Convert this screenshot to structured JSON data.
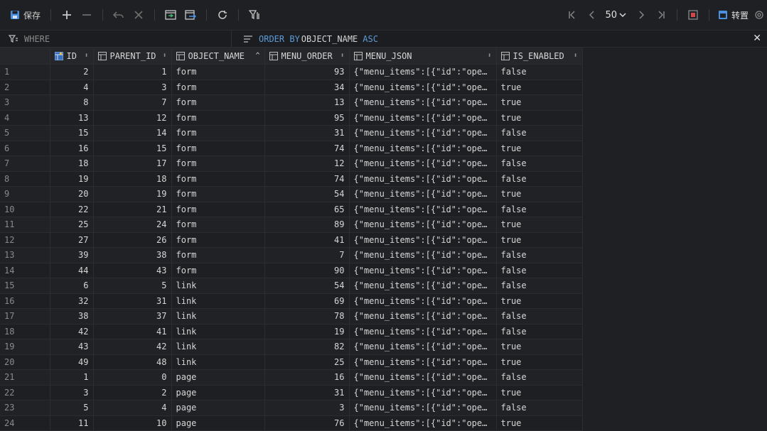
{
  "toolbar": {
    "save_label": "保存",
    "page_size": "50",
    "transpose_label": "转置"
  },
  "filter": {
    "where_placeholder": "WHERE",
    "order_kw": "ORDER BY",
    "order_col": "OBJECT_NAME",
    "order_dir": "ASC"
  },
  "columns": [
    {
      "label": "ID",
      "sort": "⬍"
    },
    {
      "label": "PARENT_ID",
      "sort": "⬍"
    },
    {
      "label": "OBJECT_NAME",
      "sort": "^"
    },
    {
      "label": "MENU_ORDER",
      "sort": "⬍"
    },
    {
      "label": "MENU_JSON",
      "sort": "⬍"
    },
    {
      "label": "IS_ENABLED",
      "sort": "⬍"
    }
  ],
  "rows": [
    [
      "1",
      "2",
      "1",
      "form",
      "93",
      "{\"menu_items\":[{\"id\":\"ope…",
      "false"
    ],
    [
      "2",
      "4",
      "3",
      "form",
      "34",
      "{\"menu_items\":[{\"id\":\"ope…",
      "true"
    ],
    [
      "3",
      "8",
      "7",
      "form",
      "13",
      "{\"menu_items\":[{\"id\":\"ope…",
      "true"
    ],
    [
      "4",
      "13",
      "12",
      "form",
      "95",
      "{\"menu_items\":[{\"id\":\"ope…",
      "true"
    ],
    [
      "5",
      "15",
      "14",
      "form",
      "31",
      "{\"menu_items\":[{\"id\":\"ope…",
      "false"
    ],
    [
      "6",
      "16",
      "15",
      "form",
      "74",
      "{\"menu_items\":[{\"id\":\"ope…",
      "true"
    ],
    [
      "7",
      "18",
      "17",
      "form",
      "12",
      "{\"menu_items\":[{\"id\":\"ope…",
      "false"
    ],
    [
      "8",
      "19",
      "18",
      "form",
      "74",
      "{\"menu_items\":[{\"id\":\"ope…",
      "false"
    ],
    [
      "9",
      "20",
      "19",
      "form",
      "54",
      "{\"menu_items\":[{\"id\":\"ope…",
      "true"
    ],
    [
      "10",
      "22",
      "21",
      "form",
      "65",
      "{\"menu_items\":[{\"id\":\"ope…",
      "false"
    ],
    [
      "11",
      "25",
      "24",
      "form",
      "89",
      "{\"menu_items\":[{\"id\":\"ope…",
      "true"
    ],
    [
      "12",
      "27",
      "26",
      "form",
      "41",
      "{\"menu_items\":[{\"id\":\"ope…",
      "true"
    ],
    [
      "13",
      "39",
      "38",
      "form",
      "7",
      "{\"menu_items\":[{\"id\":\"ope…",
      "false"
    ],
    [
      "14",
      "44",
      "43",
      "form",
      "90",
      "{\"menu_items\":[{\"id\":\"ope…",
      "false"
    ],
    [
      "15",
      "6",
      "5",
      "link",
      "54",
      "{\"menu_items\":[{\"id\":\"ope…",
      "false"
    ],
    [
      "16",
      "32",
      "31",
      "link",
      "69",
      "{\"menu_items\":[{\"id\":\"ope…",
      "true"
    ],
    [
      "17",
      "38",
      "37",
      "link",
      "78",
      "{\"menu_items\":[{\"id\":\"ope…",
      "false"
    ],
    [
      "18",
      "42",
      "41",
      "link",
      "19",
      "{\"menu_items\":[{\"id\":\"ope…",
      "false"
    ],
    [
      "19",
      "43",
      "42",
      "link",
      "82",
      "{\"menu_items\":[{\"id\":\"ope…",
      "true"
    ],
    [
      "20",
      "49",
      "48",
      "link",
      "25",
      "{\"menu_items\":[{\"id\":\"ope…",
      "true"
    ],
    [
      "21",
      "1",
      "0",
      "page",
      "16",
      "{\"menu_items\":[{\"id\":\"ope…",
      "false"
    ],
    [
      "22",
      "3",
      "2",
      "page",
      "31",
      "{\"menu_items\":[{\"id\":\"ope…",
      "true"
    ],
    [
      "23",
      "5",
      "4",
      "page",
      "3",
      "{\"menu_items\":[{\"id\":\"ope…",
      "false"
    ],
    [
      "24",
      "11",
      "10",
      "page",
      "76",
      "{\"menu_items\":[{\"id\":\"ope…",
      "true"
    ]
  ],
  "colors": {
    "bg": "#1f2023",
    "keyword": "#5c9ad8",
    "save_icon": "#4a8fe0"
  }
}
